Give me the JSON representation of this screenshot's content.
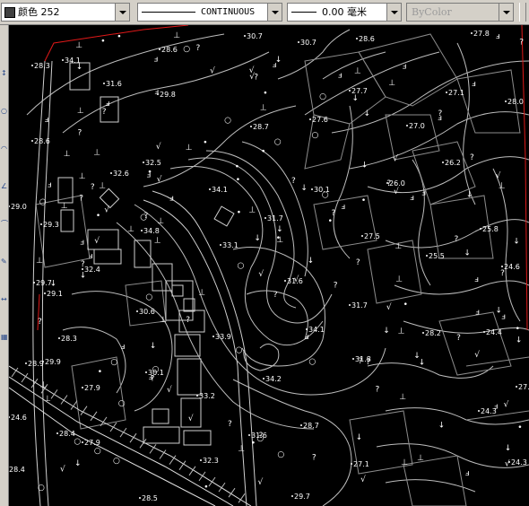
{
  "toolbar": {
    "color": {
      "swatch": "#404040",
      "label": "颜色 252"
    },
    "linetype": {
      "label": "CONTINUOUS"
    },
    "lineweight": {
      "value": "0.00",
      "unit": "毫米"
    },
    "plotstyle": {
      "label": "ByColor"
    }
  },
  "leftbar": {
    "icons": [
      "pan-icon",
      "zoom-icon",
      "circle-icon",
      "arc-icon",
      "polyline-icon",
      "edit-icon",
      "move-icon",
      "hatch-icon"
    ],
    "glyphs": [
      "↕",
      "○",
      "◠",
      "∠",
      "⌒",
      "✎",
      "↔",
      "▦"
    ]
  },
  "drawing": {
    "elevations": [
      "30.7",
      "30.7",
      "28.6",
      "27.8",
      "28.6",
      "34.1",
      "28.0",
      "31.6",
      "27.7",
      "27.1",
      "28.3",
      "29.8",
      "27.6",
      "27.0",
      "28.6",
      "28.7",
      "32.6",
      "32.5",
      "26.2",
      "34.1",
      "30.1",
      "26.0",
      "29.0",
      "34.8",
      "33.1",
      "31.7",
      "27.5",
      "25.8",
      "29.3",
      "32.4",
      "31.6",
      "25.5",
      "24.6",
      "29.7",
      "29.1",
      "30.6",
      "31.7",
      "28.2",
      "24.4",
      "28.3",
      "33.9",
      "34.1",
      "31.8",
      "28.9",
      "30.1",
      "29.9",
      "33.2",
      "34.2",
      "27.9",
      "27.8",
      "24.3",
      "24.6",
      "28.7",
      "31.6",
      "27.9",
      "28.4",
      "32.3",
      "27.1",
      "24.3",
      "28.4",
      "29.7",
      "28.5"
    ]
  }
}
